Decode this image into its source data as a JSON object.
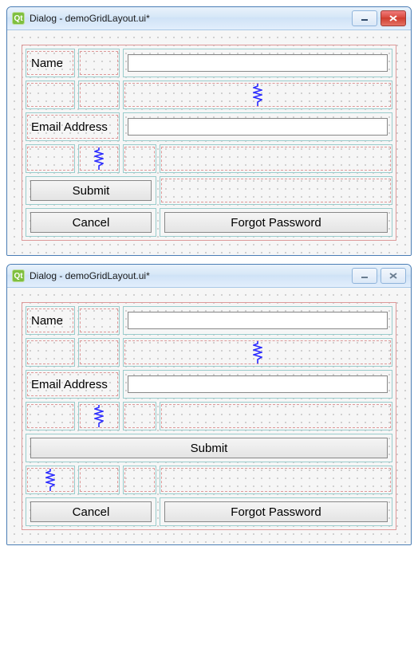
{
  "windows": [
    {
      "title": "Dialog - demoGridLayout.ui*",
      "controls": {
        "minimize": "min",
        "close": "close"
      }
    },
    {
      "title": "Dialog - demoGridLayout.ui*",
      "controls": {
        "minimize": "min",
        "close": "dis"
      }
    }
  ],
  "form": {
    "name_label": "Name",
    "email_label": "Email Address",
    "submit_label": "Submit",
    "cancel_label": "Cancel",
    "forgot_label": "Forgot Password"
  }
}
